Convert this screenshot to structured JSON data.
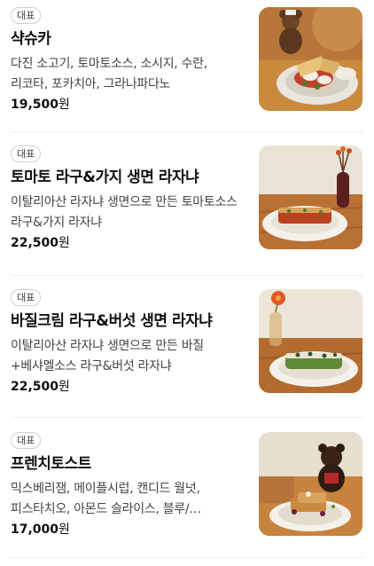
{
  "menu": {
    "items": [
      {
        "badge": "대표",
        "name": "샥슈카",
        "description": "다진 소고기, 토마토소스, 소시지, 수란, 리코타, 포카치아, 그라나파다노",
        "price": "19,500",
        "currency": "원",
        "image": "shakshuka-dish-photo"
      },
      {
        "badge": "대표",
        "name": "토마토 라구&가지 생면 라자냐",
        "description": "이탈리아산 라자냐 생면으로 만든 토마토소스 라구&가지 라자냐",
        "price": "22,500",
        "currency": "원",
        "image": "tomato-lasagna-photo"
      },
      {
        "badge": "대표",
        "name": "바질크림 라구&버섯 생면 라자냐",
        "description": "이탈리아산 라자냐 생면으로 만든 바질+베샤멜소스 라구&버섯 라자냐",
        "price": "22,500",
        "currency": "원",
        "image": "basil-lasagna-photo"
      },
      {
        "badge": "대표",
        "name": "프렌치토스트",
        "description": "믹스베리잼, 메이플시럽, 캔디드 월넛, 피스타치오, 아몬드 슬라이스, 블루/…",
        "price": "17,000",
        "currency": "원",
        "image": "french-toast-photo"
      }
    ]
  }
}
